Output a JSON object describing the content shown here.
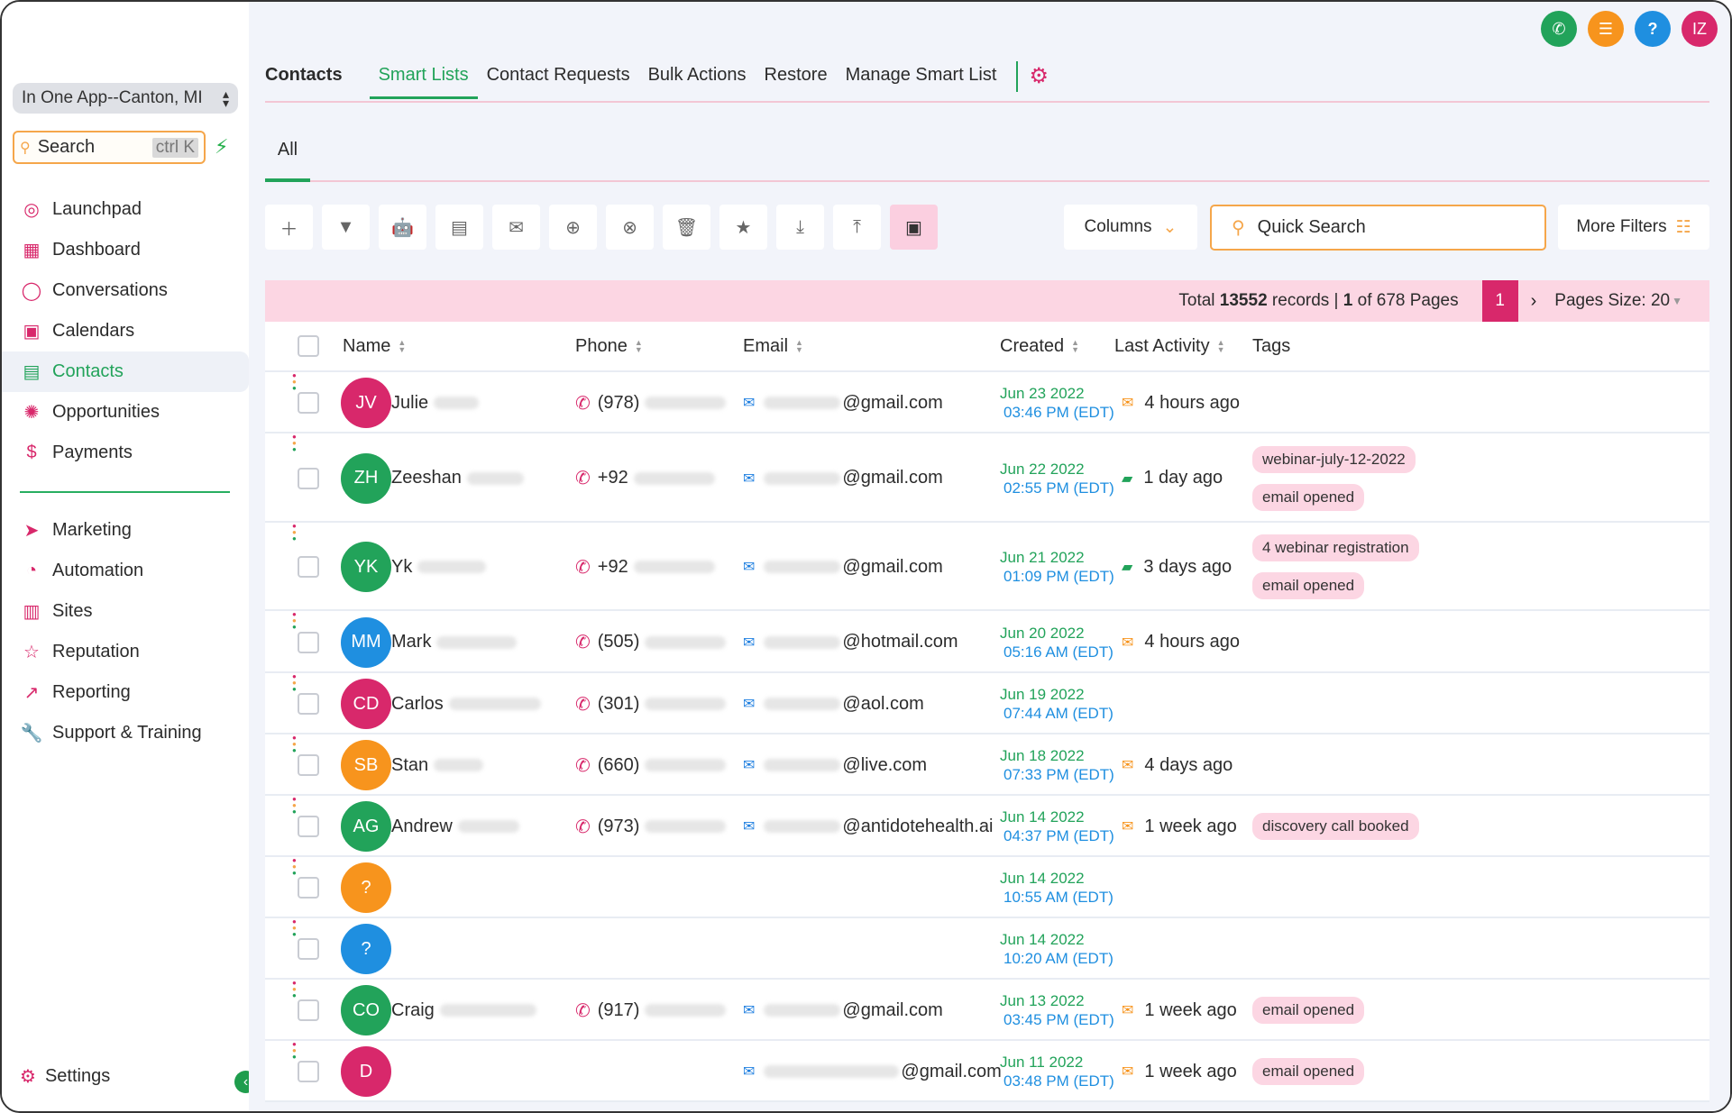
{
  "sidebar": {
    "location": "In One App--Canton, MI",
    "search_label": "Search",
    "search_shortcut": "ctrl K",
    "items": [
      {
        "label": "Launchpad",
        "icon": "launchpad-icon"
      },
      {
        "label": "Dashboard",
        "icon": "dashboard-icon"
      },
      {
        "label": "Conversations",
        "icon": "chat-icon"
      },
      {
        "label": "Calendars",
        "icon": "calendar-icon"
      },
      {
        "label": "Contacts",
        "icon": "contacts-icon",
        "active": true
      },
      {
        "label": "Opportunities",
        "icon": "opportunities-icon"
      },
      {
        "label": "Payments",
        "icon": "payments-icon"
      }
    ],
    "items2": [
      {
        "label": "Marketing",
        "icon": "send-icon"
      },
      {
        "label": "Automation",
        "icon": "automation-icon"
      },
      {
        "label": "Sites",
        "icon": "sites-icon"
      },
      {
        "label": "Reputation",
        "icon": "star-icon"
      },
      {
        "label": "Reporting",
        "icon": "trend-icon"
      },
      {
        "label": "Support & Training",
        "icon": "wrench-icon"
      }
    ],
    "settings_label": "Settings"
  },
  "header": {
    "avatar_initials": "IZ",
    "title": "Contacts",
    "tabs": [
      "Smart Lists",
      "Contact Requests",
      "Bulk Actions",
      "Restore",
      "Manage Smart List"
    ],
    "subtab": "All"
  },
  "toolbar": {
    "columns_label": "Columns",
    "quick_search_placeholder": "Quick Search",
    "more_filters_label": "More Filters"
  },
  "pagination": {
    "total_prefix": "Total",
    "total": "13552",
    "records_suffix": "records |",
    "page": "1",
    "of_label": "of 678 Pages",
    "current": "1",
    "page_size_label": "Pages Size: 20"
  },
  "table": {
    "columns": [
      "Name",
      "Phone",
      "Email",
      "Created",
      "Last Activity",
      "Tags"
    ],
    "rows": [
      {
        "initials": "JV",
        "color": "#d8286b",
        "name": "Julie",
        "phone": "(978)",
        "email": "@gmail.com",
        "date": "Jun 23 2022",
        "time": "03:46 PM (EDT)",
        "activity": "4 hours ago",
        "act_type": "email",
        "tags": []
      },
      {
        "initials": "ZH",
        "color": "#22a35a",
        "name": "Zeeshan",
        "phone": "+92",
        "email": "@gmail.com",
        "date": "Jun 22 2022",
        "time": "02:55 PM (EDT)",
        "activity": "1 day ago",
        "act_type": "sms",
        "tags": [
          "webinar-july-12-2022",
          "email opened"
        ]
      },
      {
        "initials": "YK",
        "color": "#22a35a",
        "name": "Yk",
        "phone": "+92",
        "email": "@gmail.com",
        "date": "Jun 21 2022",
        "time": "01:09 PM (EDT)",
        "activity": "3 days ago",
        "act_type": "sms",
        "tags": [
          "4 webinar registration",
          "email opened"
        ]
      },
      {
        "initials": "MM",
        "color": "#1f8fe0",
        "name": "Mark",
        "phone": "(505)",
        "email": "@hotmail.com",
        "date": "Jun 20 2022",
        "time": "05:16 AM (EDT)",
        "activity": "4 hours ago",
        "act_type": "email",
        "tags": []
      },
      {
        "initials": "CD",
        "color": "#d8286b",
        "name": "Carlos",
        "phone": "(301)",
        "email": "@aol.com",
        "date": "Jun 19 2022",
        "time": "07:44 AM (EDT)",
        "activity": "",
        "act_type": "",
        "tags": []
      },
      {
        "initials": "SB",
        "color": "#f7941d",
        "name": "Stan",
        "phone": "(660)",
        "email": "@live.com",
        "date": "Jun 18 2022",
        "time": "07:33 PM (EDT)",
        "activity": "4 days ago",
        "act_type": "email",
        "tags": []
      },
      {
        "initials": "AG",
        "color": "#22a35a",
        "name": "Andrew",
        "phone": "(973)",
        "email": "@antidotehealth.ai",
        "date": "Jun 14 2022",
        "time": "04:37 PM (EDT)",
        "activity": "1 week ago",
        "act_type": "email",
        "tags": [
          "discovery call booked"
        ]
      },
      {
        "initials": "?",
        "color": "#f7941d",
        "name": "",
        "phone": "",
        "email": "",
        "date": "Jun 14 2022",
        "time": "10:55 AM (EDT)",
        "activity": "",
        "act_type": "",
        "tags": []
      },
      {
        "initials": "?",
        "color": "#1f8fe0",
        "name": "",
        "phone": "",
        "email": "",
        "date": "Jun 14 2022",
        "time": "10:20 AM (EDT)",
        "activity": "",
        "act_type": "",
        "tags": []
      },
      {
        "initials": "CO",
        "color": "#22a35a",
        "name": "Craig",
        "phone": "(917)",
        "email": "@gmail.com",
        "date": "Jun 13 2022",
        "time": "03:45 PM (EDT)",
        "activity": "1 week ago",
        "act_type": "email",
        "tags": [
          "email opened"
        ]
      },
      {
        "initials": "D",
        "color": "#d8286b",
        "name": "",
        "phone": "",
        "email": "@gmail.com",
        "date": "Jun 11 2022",
        "time": "03:48 PM (EDT)",
        "activity": "1 week ago",
        "act_type": "email",
        "tags": [
          "email opened"
        ]
      }
    ]
  }
}
